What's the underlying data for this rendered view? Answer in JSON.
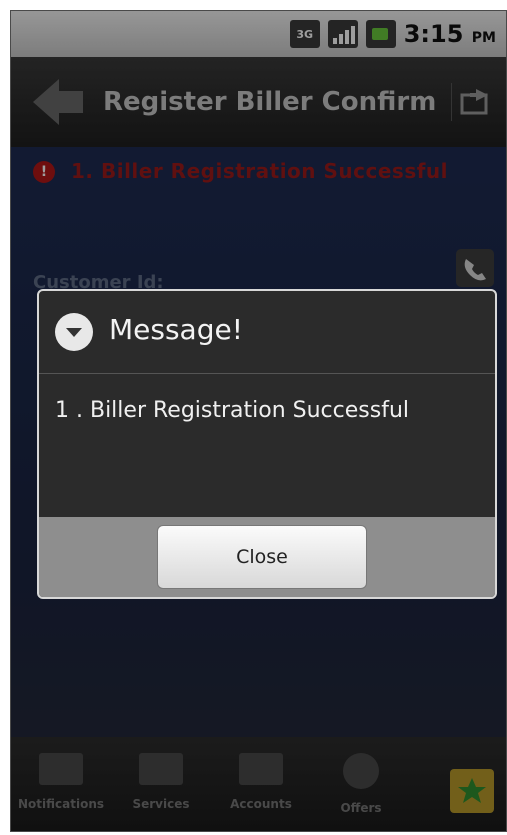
{
  "status_bar": {
    "network_badge": "3G",
    "time": "3:15",
    "ampm": "PM"
  },
  "title_bar": {
    "title": "Register Biller Confirm"
  },
  "content": {
    "error_text": "1. Biller Registration Successful",
    "customer_id_label": "Customer Id:"
  },
  "dialog": {
    "title": "Message!",
    "message": "1 . Biller Registration Successful",
    "close_label": "Close"
  },
  "bottom_nav": {
    "items": [
      {
        "label": "Notifications"
      },
      {
        "label": "Services"
      },
      {
        "label": "Accounts"
      },
      {
        "label": "Offers"
      }
    ]
  }
}
